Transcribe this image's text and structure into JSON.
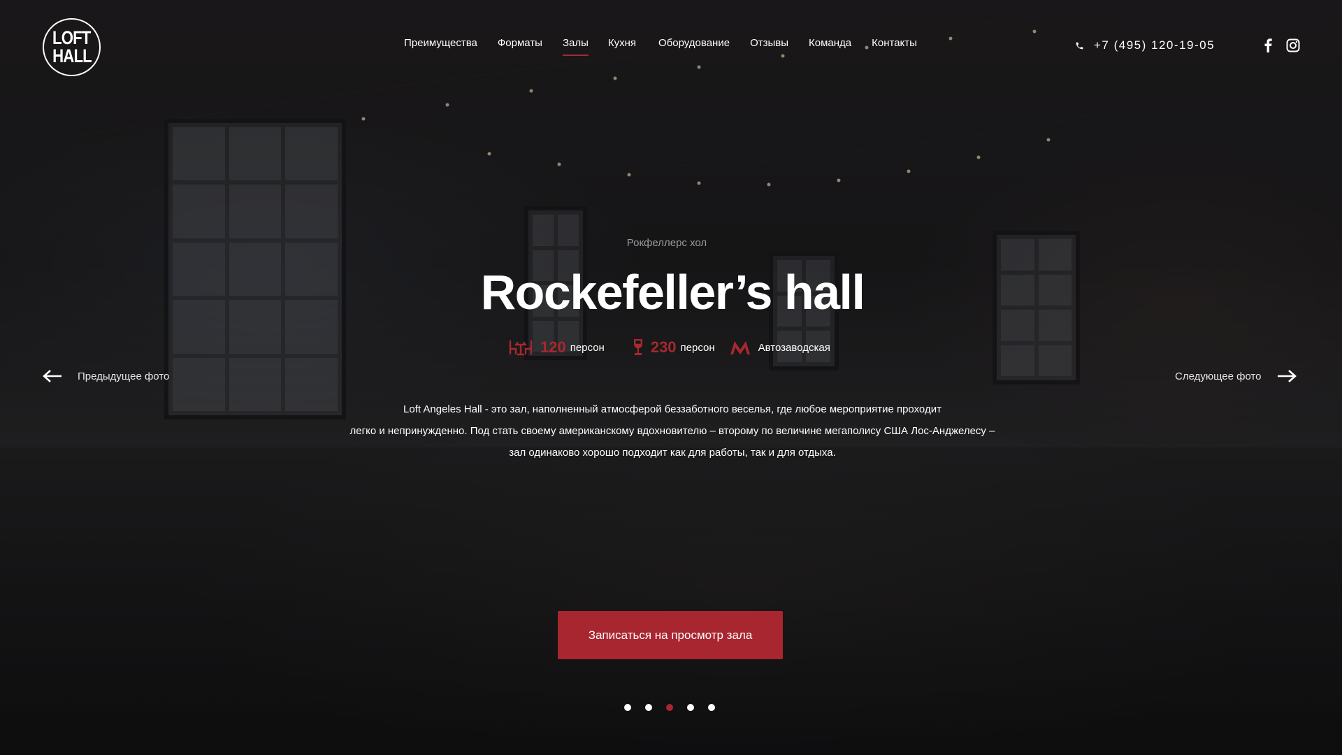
{
  "brand": {
    "logo_line1": "LOFT",
    "logo_line2": "HALL"
  },
  "nav": {
    "items": [
      {
        "label": "Преимущества"
      },
      {
        "label": "Форматы"
      },
      {
        "label": "Залы",
        "active": true
      },
      {
        "label": "Кухня"
      },
      {
        "label": "Оборудование"
      },
      {
        "label": "Отзывы"
      },
      {
        "label": "Команда"
      },
      {
        "label": "Контакты"
      }
    ]
  },
  "contact": {
    "phone": "+7 (495) 120-19-05",
    "phone_icon": "phone-icon"
  },
  "social": {
    "facebook_icon": "facebook-icon",
    "instagram_icon": "instagram-icon"
  },
  "hall": {
    "subtitle": "Рокфеллерс хол",
    "title": "Rockefeller’s hall",
    "stats": [
      {
        "icon": "banquet-table-icon",
        "value": "120",
        "unit": "персон"
      },
      {
        "icon": "wine-glass-icon",
        "value": "230",
        "unit": "персон"
      }
    ],
    "metro": {
      "icon": "metro-icon",
      "station": "Автозаводская"
    },
    "description_lines": [
      "Loft Angeles Hall - это зал, наполненный атмосферой беззаботного веселья, где любое мероприятие проходит",
      "легко и непринужденно. Под стать своему американскому вдохновителю – второму по величине мегаполису США Лос-Анджелесу –",
      "зал одинаково хорошо подходит как для работы, так и для отдыха."
    ]
  },
  "slider": {
    "prev_label": "Предыдущее фото",
    "next_label": "Следующее фото",
    "total_slides": 5,
    "active_slide": 3
  },
  "cta": {
    "label": "Записаться на просмотр зала"
  },
  "colors": {
    "accent": "#a8282f",
    "text": "#ffffff",
    "muted": "#9a9a9c"
  }
}
